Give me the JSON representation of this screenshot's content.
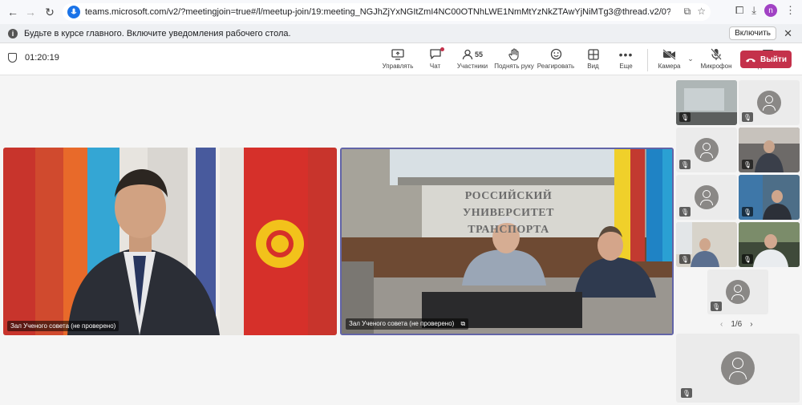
{
  "browser": {
    "url": "teams.microsoft.com/v2/?meetingjoin=true#/l/meetup-join/19:meeting_NGJhZjYxNGItZmI4NC00OTNhLWE1NmMtYzNkZTAwYjNiMTg3@thread.v2/0?context=%7b\"Tid\"%3a\"4147edf...",
    "profile_initial": "n"
  },
  "notification": {
    "text": "Будьте в курсе главного. Включите уведомления рабочего стола.",
    "button_label": "Включить"
  },
  "meeting": {
    "timer": "01:20:19",
    "participants_count": "55",
    "leave_label": "Выйти"
  },
  "toolbar": [
    {
      "label": "Управлять",
      "icon": "share-screen-icon"
    },
    {
      "label": "Чат",
      "icon": "chat-icon"
    },
    {
      "label": "Участники",
      "icon": "people-icon"
    },
    {
      "label": "Поднять руку",
      "icon": "raise-hand-icon"
    },
    {
      "label": "Реагировать",
      "icon": "react-icon"
    },
    {
      "label": "Вид",
      "icon": "view-grid-icon"
    },
    {
      "label": "Еще",
      "icon": "more-icon"
    },
    {
      "label": "Камера",
      "icon": "camera-off-icon"
    },
    {
      "label": "Микрофон",
      "icon": "mic-off-icon"
    },
    {
      "label": "Поделиться",
      "icon": "share-icon"
    }
  ],
  "videos": [
    {
      "label": "Зал Ученого совета (не проверено)"
    },
    {
      "label": "Зал Ученого совета (не проверено)"
    }
  ],
  "banner_text": [
    "РОССИЙСКИЙ",
    "УНИВЕРСИТЕТ",
    "ТРАНСПОРТА"
  ],
  "pager": {
    "text": "1/6"
  },
  "colors": {
    "accent": "#6264a7",
    "leave": "#c4314b"
  }
}
